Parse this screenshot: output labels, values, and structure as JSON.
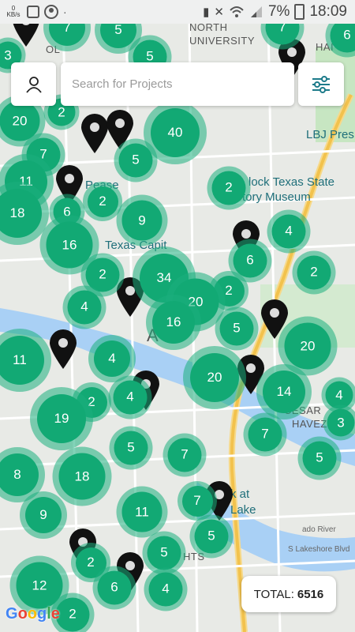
{
  "status_bar": {
    "speed_value": "0",
    "speed_unit": "KB/s",
    "battery": "7%",
    "time": "18:09"
  },
  "search": {
    "placeholder": "Search for Projects",
    "value": ""
  },
  "total": {
    "label": "TOTAL:",
    "value": "6516"
  },
  "attribution": "Google",
  "map_labels": [
    {
      "text": "NORTH",
      "style": "dark"
    },
    {
      "text": "UNIVERSITY",
      "style": "dark"
    },
    {
      "text": "LBJ Pres",
      "style": "poi"
    },
    {
      "text": "lock Texas State",
      "style": "poi"
    },
    {
      "text": "tory Museum",
      "style": "poi"
    },
    {
      "text": "Texas Capit",
      "style": "poi"
    },
    {
      "text": "Pease",
      "style": "poi"
    },
    {
      "text": "A",
      "style": "dark"
    },
    {
      "text": "CESAR",
      "style": "dark"
    },
    {
      "text": "HAVEZ",
      "style": "dark"
    },
    {
      "text": "k at",
      "style": "poi"
    },
    {
      "text": "Lake",
      "style": "poi"
    },
    {
      "text": "S Lakeshore Blvd",
      "style": "small"
    },
    {
      "text": "ado River",
      "style": "small"
    },
    {
      "text": "HTS",
      "style": "dark"
    },
    {
      "text": "HAI",
      "style": "dark"
    },
    {
      "text": "OL",
      "style": "dark"
    }
  ],
  "clusters": [
    "7",
    "5",
    "6",
    "3",
    "7",
    "5",
    "20",
    "2",
    "40",
    "5",
    "7",
    "11",
    "6",
    "2",
    "9",
    "2",
    "4",
    "18",
    "16",
    "2",
    "34",
    "2",
    "20",
    "6",
    "2",
    "4",
    "16",
    "5",
    "4",
    "11",
    "20",
    "4",
    "14",
    "20",
    "2",
    "4",
    "19",
    "7",
    "3",
    "5",
    "7",
    "5",
    "8",
    "18",
    "11",
    "7",
    "9",
    "5",
    "2",
    "5",
    "12",
    "6",
    "4",
    "2"
  ]
}
